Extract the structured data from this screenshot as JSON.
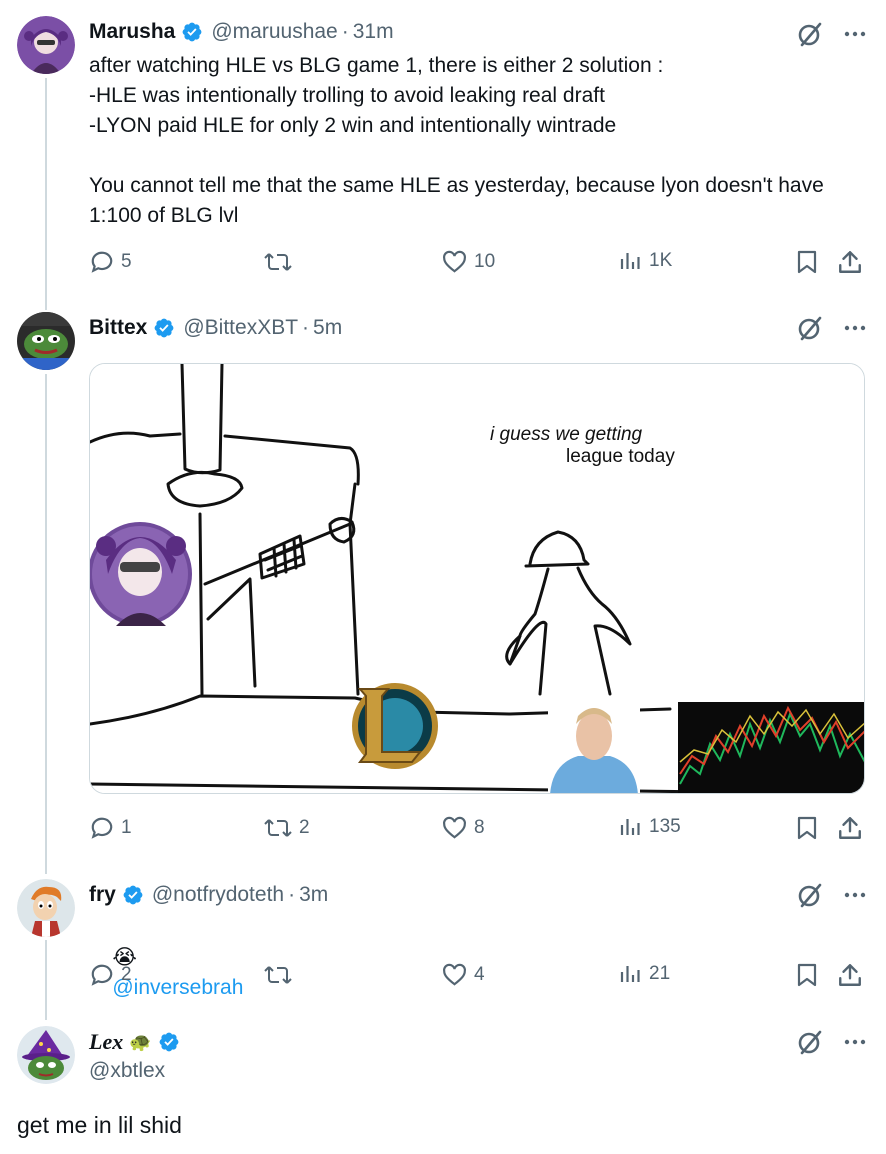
{
  "tweets": [
    {
      "name": "Marusha",
      "handle": "@maruushae",
      "time": "31m",
      "body": "after watching HLE vs BLG game 1, there is either 2 solution :\n-HLE was intentionally trolling to avoid leaking real draft\n-LYON paid HLE for only 2 win and intentionally wintrade\n\nYou cannot tell me that the same HLE as yesterday, because lyon doesn't have\n1:100 of BLG lvl",
      "replies": "5",
      "retweets": "",
      "likes": "10",
      "views": "1K"
    },
    {
      "name": "Bittex",
      "handle": "@BittexXBT",
      "time": "5m",
      "media_text_1": "i guess we getting",
      "media_text_2": "league today",
      "replies": "1",
      "retweets": "2",
      "likes": "8",
      "views": "135"
    },
    {
      "name": "fry",
      "handle": "@notfrydoteth",
      "time": "3m",
      "emoji": "😭",
      "mention": "@inversebrah",
      "replies": "2",
      "retweets": "",
      "likes": "4",
      "views": "21"
    },
    {
      "name": "Lex",
      "name_emoji": "🐢",
      "handle": "@xbtlex"
    }
  ],
  "reply_input": {
    "value": "get me in lil shid"
  },
  "colors": {
    "accent": "#1d9bf0",
    "muted": "#536471",
    "line": "#cfd9de",
    "text": "#0f1419"
  },
  "icons": [
    "grok-slash-icon",
    "more-icon",
    "reply-icon",
    "retweet-icon",
    "like-icon",
    "views-icon",
    "bookmark-icon",
    "share-icon",
    "verified-icon"
  ]
}
